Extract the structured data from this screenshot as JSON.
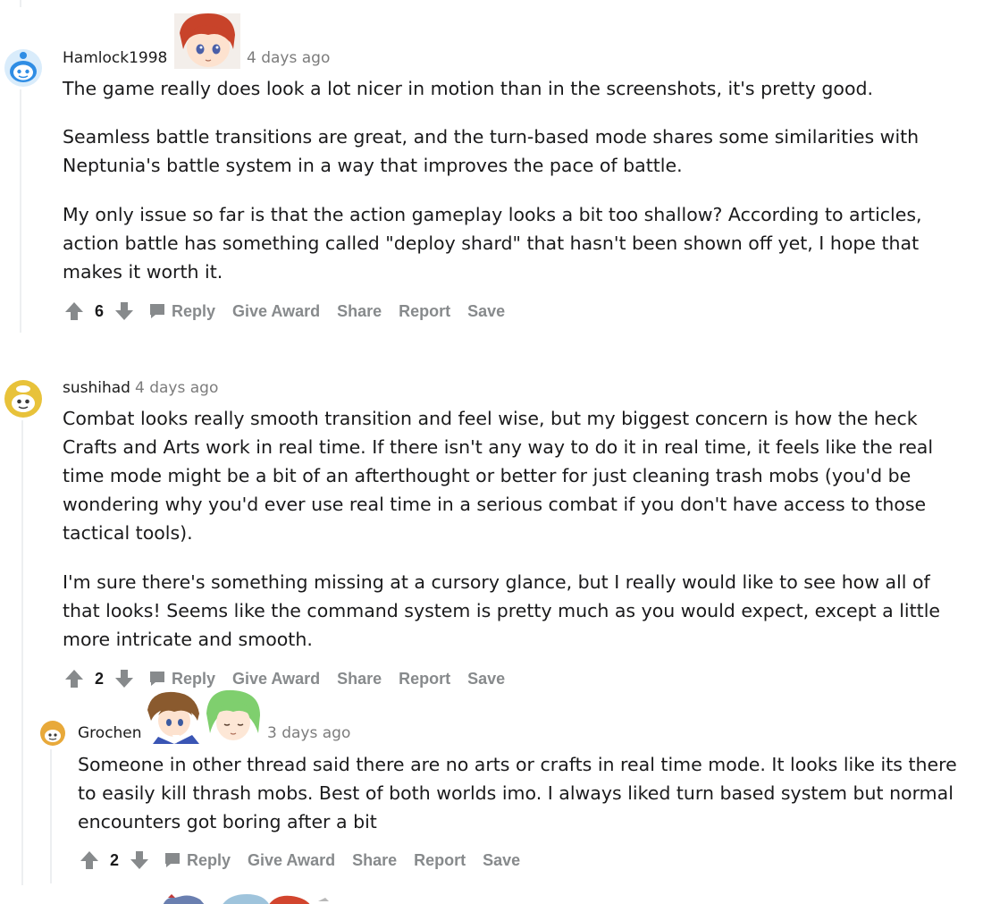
{
  "comments": [
    {
      "username": "Hamlock1998",
      "time": "4 days ago",
      "paragraphs": [
        [
          "The game really does look a lot nicer in motion than in the screenshots, it's pretty good."
        ],
        [
          "Seamless battle transitions are great, and the turn-based mode shares some similarities with",
          "Neptunia's battle system in a way that improves the pace of battle."
        ],
        [
          "My only issue so far is that the action gameplay looks a bit too shallow? According to articles,",
          "action battle has something called \"deploy shard\" that hasn't been shown off yet, I hope that",
          "makes it worth it."
        ]
      ],
      "score": "6"
    },
    {
      "username": "sushihad",
      "time": "4 days ago",
      "paragraphs": [
        [
          "Combat looks really smooth transition and feel wise, but my biggest concern is how the heck",
          "Crafts and Arts work in real time. If there isn't any way to do it in real time, it feels like the real",
          "time mode might be a bit of an afterthought or better for just cleaning trash mobs (you'd be",
          "wondering why you'd ever use real time in a serious combat if you don't have access to those",
          "tactical tools)."
        ],
        [
          "I'm sure there's something missing at a cursory glance, but I really would like to see how all of",
          "that looks! Seems like the command system is pretty much as you would expect, except a little",
          "more intricate and smooth."
        ]
      ],
      "score": "2"
    },
    {
      "username": "Grochen",
      "time": "3 days ago",
      "paragraphs": [
        [
          "Someone in other thread said there are no arts or crafts in real time mode. It looks like its there",
          "to easily kill thrash mobs. Best of both worlds imo. I always liked turn based system but normal",
          "encounters got boring after a bit"
        ]
      ],
      "score": "2"
    }
  ],
  "actions": {
    "reply": "Reply",
    "give_award": "Give Award",
    "share": "Share",
    "report": "Report",
    "save": "Save"
  },
  "icons": {
    "upvote": "upvote-arrow-icon",
    "downvote": "downvote-arrow-icon",
    "reply": "speech-bubble-icon",
    "avatar": "snoo-avatar-icon"
  },
  "colors": {
    "action_text": "#878a8c",
    "timestamp": "#7c7c7c",
    "thread_line": "#edeff1",
    "avatar_blue": "#2f8de4",
    "avatar_yellow": "#e8c23a"
  }
}
